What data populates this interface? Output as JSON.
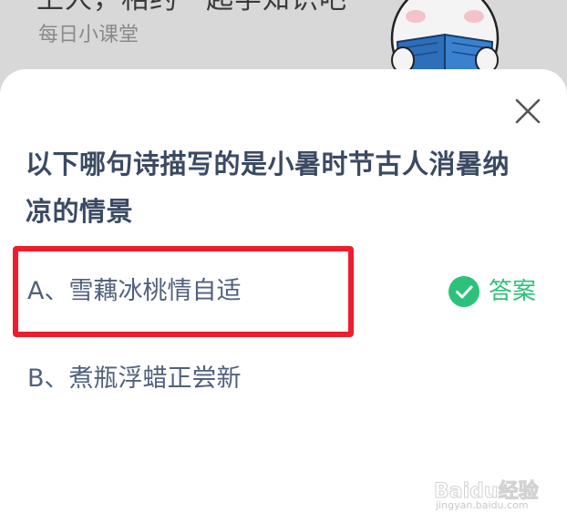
{
  "background_page": {
    "title": "上人，相约一起学知识吧",
    "subtitle": "每日小课堂"
  },
  "quiz": {
    "question": "以下哪句诗描写的是小暑时节古人消暑纳凉的情景",
    "options": [
      {
        "text": "A、雪藕冰桃情自适",
        "is_answer": true,
        "answer_label": "答案"
      },
      {
        "text": "B、煮瓶浮蜡正尝新",
        "is_answer": false
      }
    ]
  },
  "watermark": {
    "brand": "Baidu经验",
    "url": "jingyan.baidu.com"
  },
  "colors": {
    "question_text": "#3b4a63",
    "option_text": "#50617d",
    "answer_green": "#2cc27b",
    "highlight_red": "#ee1d2b"
  },
  "icons": {
    "close": "close-icon",
    "correct": "check-circle-icon",
    "mascot": "mascot-reading-book-icon"
  }
}
